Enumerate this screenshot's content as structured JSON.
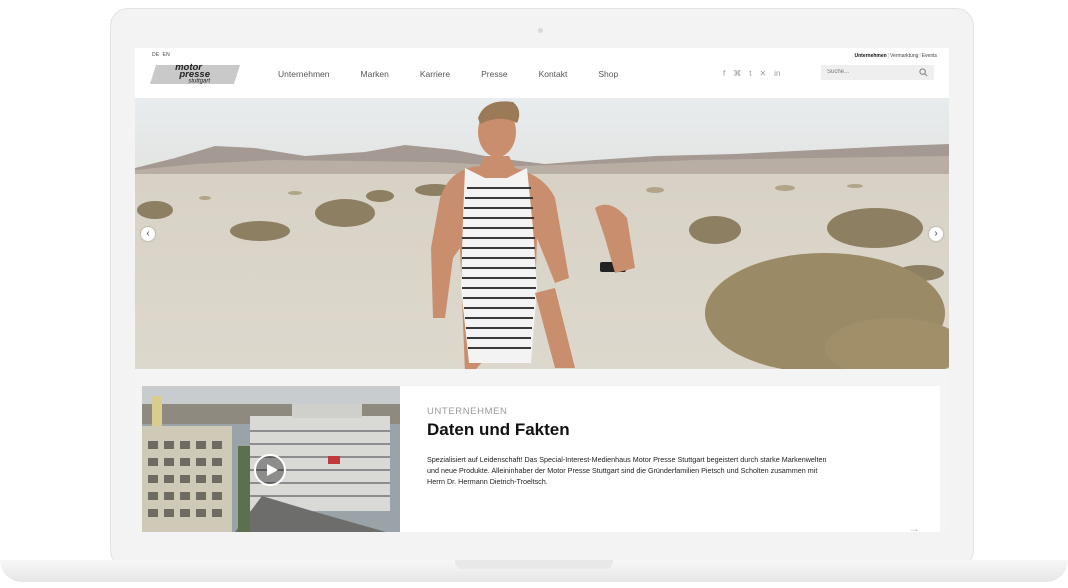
{
  "header": {
    "lang": [
      "DE",
      "EN"
    ],
    "logo_lines": [
      "motor",
      "presse",
      "stuttgart"
    ],
    "top_links": [
      "Unternehmen",
      "|",
      "Vermarktung",
      "|",
      "Events"
    ],
    "nav": [
      "Unternehmen",
      "Marken",
      "Karriere",
      "Presse",
      "Kontakt",
      "Shop"
    ],
    "social_icons": [
      "facebook-icon",
      "xing-icon",
      "twitter-icon",
      "xing-alt-icon",
      "linkedin-icon"
    ],
    "social_glyphs": [
      "f",
      "⌘",
      "t",
      "✕",
      "in"
    ],
    "search_placeholder": "Suche..."
  },
  "hero": {
    "prev_glyph": "‹",
    "next_glyph": "›"
  },
  "teaser": {
    "eyebrow": "UNTERNEHMEN",
    "headline": "Daten und Fakten",
    "body": "Spezialisiert auf Leidenschaft! Das Special-Interest-Medienhaus Motor Presse Stuttgart begeistert durch starke Markenwelten und neue Produkte. Alleininhaber der Motor Presse Stuttgart sind die Gründerfamilien Pietsch und Scholten zusammen mit Herrn Dr. Hermann Dietrich-Troeltsch.",
    "more_glyph": "→"
  },
  "colors": {
    "accent": "#9a9a9a",
    "text": "#111111"
  }
}
